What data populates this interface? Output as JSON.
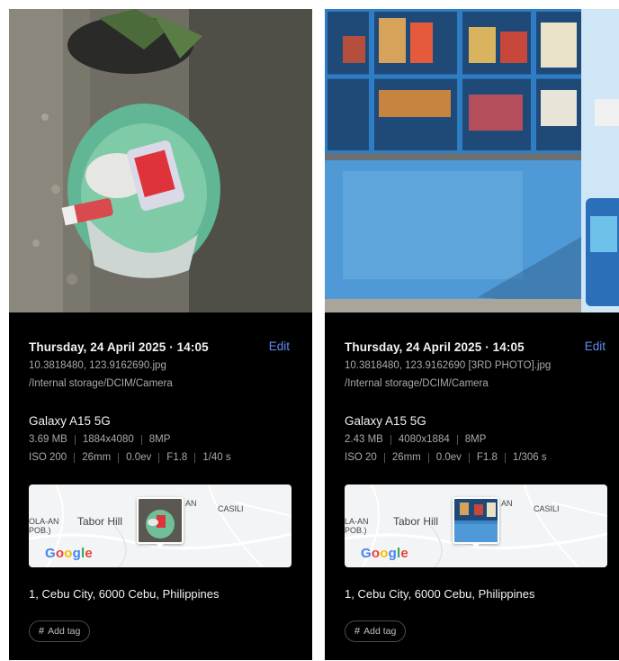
{
  "panels": [
    {
      "date": "Thursday, 24 April 2025 · 14:05",
      "edit_label": "Edit",
      "filename": "10.3818480, 123.9162690.jpg",
      "path": "/Internal storage/DCIM/Camera",
      "device": "Galaxy A15 5G",
      "specs1": [
        "3.69 MB",
        "1884x4080",
        "8MP"
      ],
      "specs2": [
        "ISO 200",
        "26mm",
        "0.0ev",
        "F1.8",
        "1/40 s"
      ],
      "map": {
        "place_main": "Tabor Hill",
        "place_left": "OLA-AN\n(POB.)",
        "place_left_line1": "OLA-AN",
        "place_left_line2": "POB.)",
        "place_right": "CASILI",
        "place_top": "AN",
        "logo": [
          "G",
          "o",
          "o",
          "g",
          "l",
          "e"
        ]
      },
      "address": "1, Cebu City, 6000 Cebu, Philippines",
      "add_tag": "Add tag",
      "tag_icon": "hash-icon"
    },
    {
      "date": "Thursday, 24 April 2025 · 14:05",
      "edit_label": "Edit",
      "filename": "10.3818480, 123.9162690 [3RD PHOTO].jpg",
      "path": "/Internal storage/DCIM/Camera",
      "device": "Galaxy A15 5G",
      "specs1": [
        "2.43 MB",
        "4080x1884",
        "8MP"
      ],
      "specs2": [
        "ISO 20",
        "26mm",
        "0.0ev",
        "F1.8",
        "1/306 s"
      ],
      "map": {
        "place_main": "Tabor Hill",
        "place_left_line1": "LA-AN",
        "place_left_line2": "POB.)",
        "place_right": "CASILI",
        "place_top": "AN",
        "logo": [
          "G",
          "o",
          "o",
          "g",
          "l",
          "e"
        ]
      },
      "address": "1, Cebu City, 6000 Cebu, Philippines",
      "add_tag": "Add tag",
      "tag_icon": "hash-icon"
    }
  ],
  "colors": {
    "background": "#000000",
    "primary_text": "#f2f2f2",
    "secondary_text": "#a9a9a9",
    "accent": "#5e8ef0"
  }
}
